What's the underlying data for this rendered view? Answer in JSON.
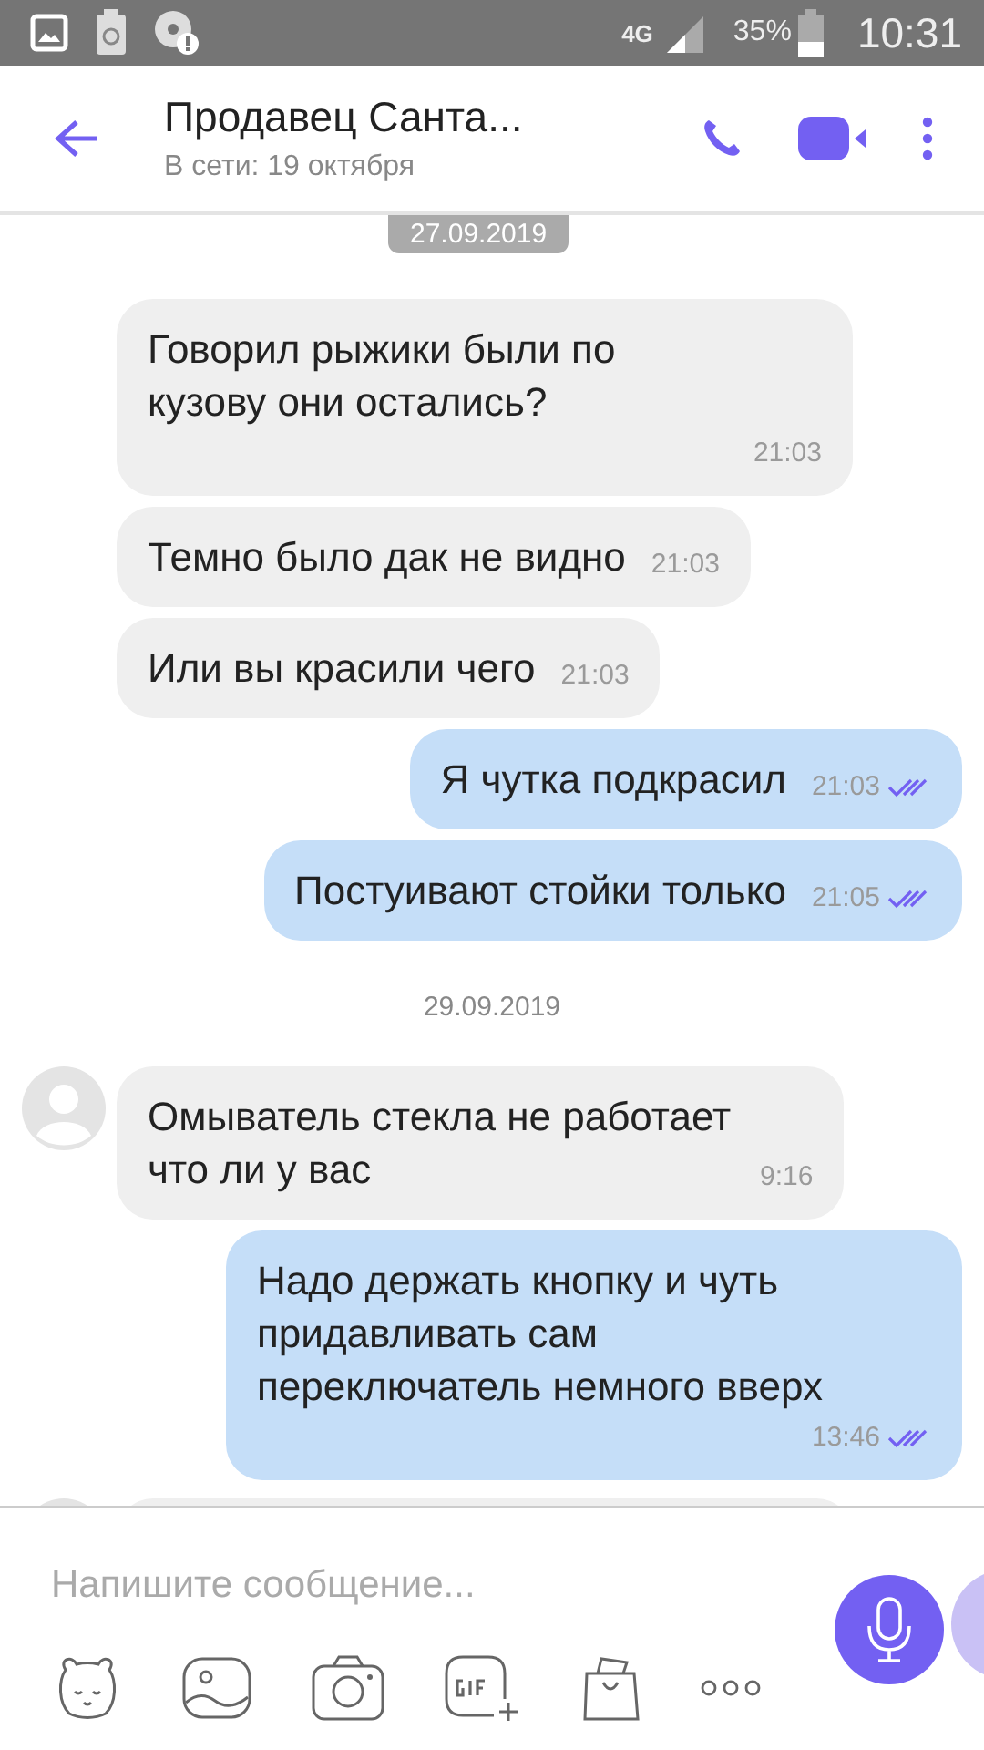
{
  "status_bar": {
    "network": "4G",
    "battery": "35%",
    "time": "10:31"
  },
  "header": {
    "title": "Продавец Санта...",
    "subtitle": "В сети: 19 октября"
  },
  "sticky_date": "27.09.2019",
  "messages": [
    {
      "kind": "in",
      "avatar": false,
      "text": "Говорил рыжики были по кузову они остались?",
      "time": "21:03"
    },
    {
      "kind": "in",
      "avatar": false,
      "text": "Темно было дак не видно",
      "time": "21:03"
    },
    {
      "kind": "in",
      "avatar": false,
      "text": "Или вы красили чего",
      "time": "21:03"
    },
    {
      "kind": "out",
      "read": true,
      "text": "Я чутка подкрасил",
      "time": "21:03"
    },
    {
      "kind": "out",
      "read": true,
      "text": "Постуивают стойки только",
      "time": "21:05"
    },
    {
      "kind": "date",
      "text": "29.09.2019"
    },
    {
      "kind": "in",
      "avatar": true,
      "text": "Омыватель стекла не работает что ли у вас",
      "time": "9:16"
    },
    {
      "kind": "out",
      "read": true,
      "text": "Надо держать кнопку и чуть придавливать сам переключатель немного вверх",
      "time": "13:46"
    },
    {
      "kind": "partial",
      "avatar": true
    }
  ],
  "composer": {
    "placeholder": "Напишите сообщение..."
  }
}
